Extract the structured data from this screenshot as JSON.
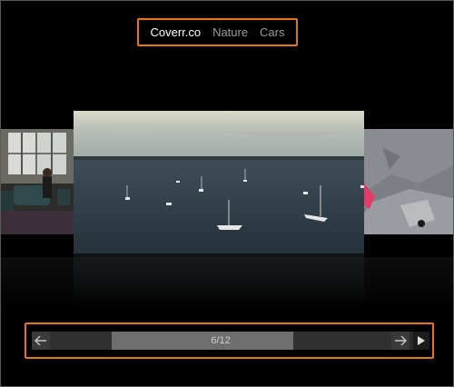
{
  "nav": {
    "items": [
      {
        "label": "Coverr.co",
        "active": true
      },
      {
        "label": "Nature",
        "active": false
      },
      {
        "label": "Cars",
        "active": false
      }
    ]
  },
  "carousel": {
    "counter": "6/12",
    "current": 6,
    "total": 12
  },
  "controls": {
    "prev_icon": "arrow-left-icon",
    "next_icon": "arrow-right-icon",
    "play_icon": "play-icon"
  },
  "colors": {
    "highlight_border": "#e8731c",
    "background": "#000000"
  }
}
